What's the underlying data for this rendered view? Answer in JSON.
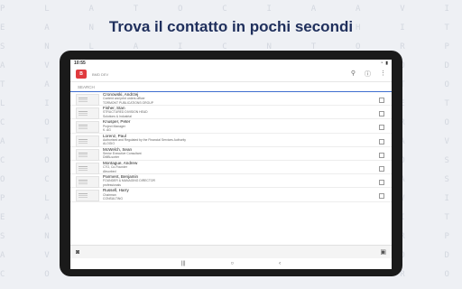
{
  "headline": "Trova il contatto in pochi secondi",
  "status": {
    "time": "10:55"
  },
  "app": {
    "logo_label": "B",
    "subtitle": "BMD DEV"
  },
  "search": {
    "placeholder": "SEARCH"
  },
  "contacts": [
    {
      "name": "Cronowski, Andrzej",
      "role": "Content and print orders officer",
      "company": "TORMONT PUBLICATIONS GROUP"
    },
    {
      "name": "Fisher, Stan",
      "role": "STRUCTURED DIVISION HEAD",
      "company": "Solutions & Industrial"
    },
    {
      "name": "Knusper, Peter",
      "role": "Project Manager",
      "company": "K. AG"
    },
    {
      "name": "Lorenz, Paul",
      "role": "Authorised and Regulated by the Financial Services Authority",
      "company": "ALOGIO"
    },
    {
      "name": "McWelch, Sean",
      "role": "Senior Executive Consultant",
      "company": "DMBLsorter"
    },
    {
      "name": "Montague, Andrew",
      "role": "CTO, Co-Founder",
      "company": "Absorbed"
    },
    {
      "name": "Parment, Benjamin",
      "role": "FOUNDER & MANAGING DIRECTOR",
      "company": "professionals"
    },
    {
      "name": "Russell, Harry",
      "role": "Chairman",
      "company": "CONSULTING"
    }
  ],
  "icons": {
    "camera": "camera-icon",
    "gallery": "image-icon",
    "filter": "filter-icon",
    "info": "info-icon",
    "more": "more-vertical-icon"
  }
}
